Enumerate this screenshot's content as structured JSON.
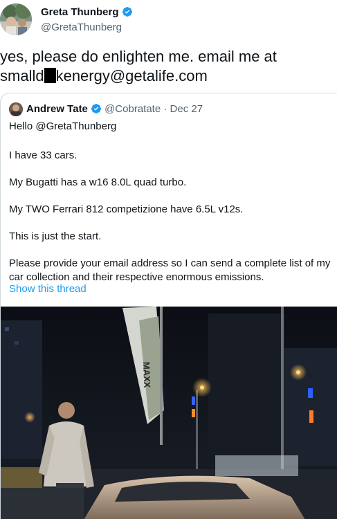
{
  "tweet": {
    "author_name": "Greta Thunberg",
    "author_handle": "@GretaThunberg",
    "text_line1": "yes, please do enlighten me. email me at",
    "text_line2_before": "smalld",
    "text_line2_after": "kenergy@getalife.com"
  },
  "quote": {
    "author_name": "Andrew Tate",
    "author_handle": "@Cobratate",
    "separator": "·",
    "date": "Dec 27",
    "lines": [
      "Hello @GretaThunberg",
      "I have 33 cars.",
      "My Bugatti has a w16 8.0L quad turbo.",
      "My TWO Ferrari 812 competizione have 6.5L v12s.",
      "This is just the start.",
      "Please provide your email address so I can send a complete list of my car collection and their respective enormous emissions."
    ],
    "show_thread_label": "Show this thread",
    "banner_text": "MAXX"
  },
  "colors": {
    "verified": "#1d9bf0",
    "link": "#1d9bf0",
    "secondary_text": "#536471"
  },
  "icons": {
    "verified": "verified-badge-icon"
  }
}
